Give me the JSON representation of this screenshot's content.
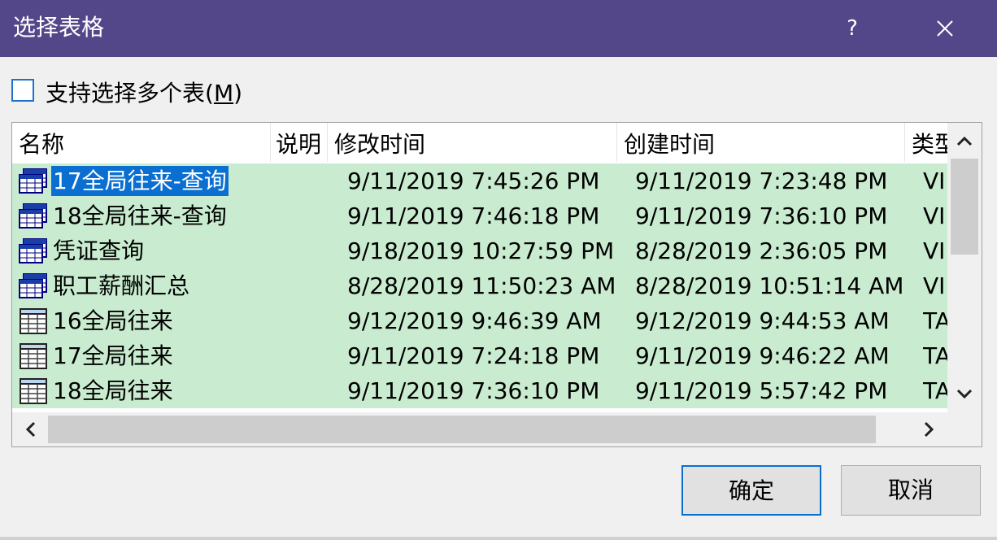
{
  "dialog": {
    "title": "选择表格",
    "help_label": "?",
    "accent_color": "#544789",
    "selection_color": "#0a6fd0",
    "row_color": "#c9ecd0"
  },
  "multi_select": {
    "label_prefix": "支持选择多个表(",
    "label_key": "M",
    "label_suffix": ")",
    "checked": false
  },
  "table": {
    "columns": [
      "名称",
      "说明",
      "修改时间",
      "创建时间",
      "类型"
    ],
    "rows": [
      {
        "icon": "view-icon",
        "name": "17全局往来-查询",
        "desc": "",
        "modified": "9/11/2019 7:45:26 PM",
        "created": "9/11/2019 7:23:48 PM",
        "type": "VIEW",
        "selected": true
      },
      {
        "icon": "view-icon",
        "name": "18全局往来-查询",
        "desc": "",
        "modified": "9/11/2019 7:46:18 PM",
        "created": "9/11/2019 7:36:10 PM",
        "type": "VIEW",
        "selected": false
      },
      {
        "icon": "view-icon",
        "name": "凭证查询",
        "desc": "",
        "modified": "9/18/2019 10:27:59 PM",
        "created": "8/28/2019 2:36:05 PM",
        "type": "VIEW",
        "selected": false
      },
      {
        "icon": "view-icon",
        "name": "职工薪酬汇总",
        "desc": "",
        "modified": "8/28/2019 11:50:23 AM",
        "created": "8/28/2019 10:51:14 AM",
        "type": "VIEW",
        "selected": false
      },
      {
        "icon": "table-icon",
        "name": "16全局往来",
        "desc": "",
        "modified": "9/12/2019 9:46:39 AM",
        "created": "9/12/2019 9:44:53 AM",
        "type": "TABLE",
        "selected": false
      },
      {
        "icon": "table-icon",
        "name": "17全局往来",
        "desc": "",
        "modified": "9/11/2019 7:24:18 PM",
        "created": "9/11/2019 9:46:22 AM",
        "type": "TABLE",
        "selected": false
      },
      {
        "icon": "table-icon",
        "name": "18全局往来",
        "desc": "",
        "modified": "9/11/2019 7:36:10 PM",
        "created": "9/11/2019 5:57:42 PM",
        "type": "TABLE",
        "selected": false
      }
    ]
  },
  "buttons": {
    "ok": "确定",
    "cancel": "取消"
  }
}
